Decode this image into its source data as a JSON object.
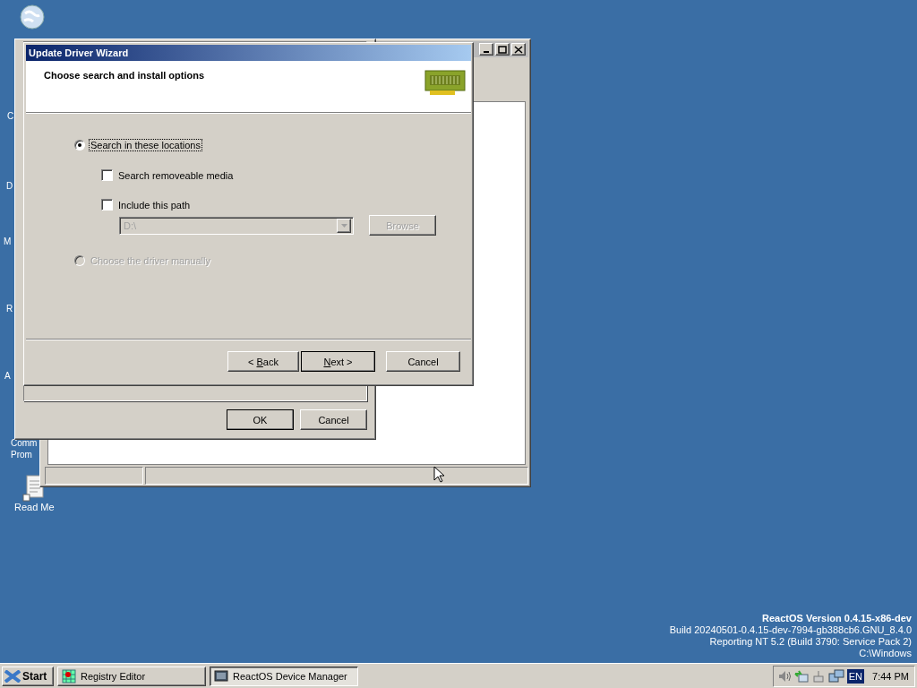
{
  "desktop_icons": [
    {
      "kind": "globe"
    },
    {
      "kind": "label",
      "lines": [
        "C"
      ]
    },
    {
      "kind": "label",
      "lines": [
        "D"
      ]
    },
    {
      "kind": "label",
      "lines": [
        "M"
      ]
    },
    {
      "kind": "label",
      "lines": [
        "R"
      ]
    },
    {
      "kind": "label",
      "lines": [
        "A"
      ]
    },
    {
      "kind": "label",
      "lines": [
        "Comm",
        "Prom"
      ]
    },
    {
      "kind": "document",
      "lines": [
        "Read Me"
      ]
    }
  ],
  "properties_dialog": {
    "buttons": [
      {
        "label": "OK",
        "default": true
      },
      {
        "label": "Cancel",
        "default": false
      }
    ]
  },
  "wizard": {
    "title": "Update Driver Wizard",
    "heading": "Choose search and install options",
    "options": [
      {
        "kind": "radio",
        "label": "Search in these locations",
        "selected": true,
        "disabled": false,
        "focused": true
      },
      {
        "kind": "checkbox",
        "label": "Search removeable media",
        "checked": false,
        "disabled": false
      },
      {
        "kind": "checkbox",
        "label": "Include this path",
        "checked": false,
        "disabled": false
      },
      {
        "kind": "path",
        "value": "D:\\",
        "disabled": true,
        "button": "Browse"
      },
      {
        "kind": "radio",
        "label": "Choose the driver manually",
        "selected": false,
        "disabled": true,
        "focused": false
      }
    ],
    "buttons": [
      {
        "label_before": "< ",
        "access_key": "B",
        "label_after": "ack",
        "default": false
      },
      {
        "access_key": "N",
        "label_after": "ext >",
        "default": true
      },
      {
        "label": "Cancel",
        "default": false
      }
    ]
  },
  "version_info": [
    {
      "text": "ReactOS Version 0.4.15-x86-dev",
      "bold": true
    },
    {
      "text": "Build 20240501-0.4.15-dev-7994-gb388cb6.GNU_8.4.0",
      "bold": false
    },
    {
      "text": "Reporting NT 5.2 (Build 3790: Service Pack 2)",
      "bold": false
    },
    {
      "text": "C:\\Windows",
      "bold": false
    }
  ],
  "taskbar": {
    "start": "Start",
    "tasks": [
      {
        "label": "Registry Editor",
        "selected": false
      },
      {
        "label": "ReactOS Device Manager",
        "selected": true
      }
    ],
    "tray": {
      "language": "EN",
      "time": "7:44 PM"
    }
  }
}
